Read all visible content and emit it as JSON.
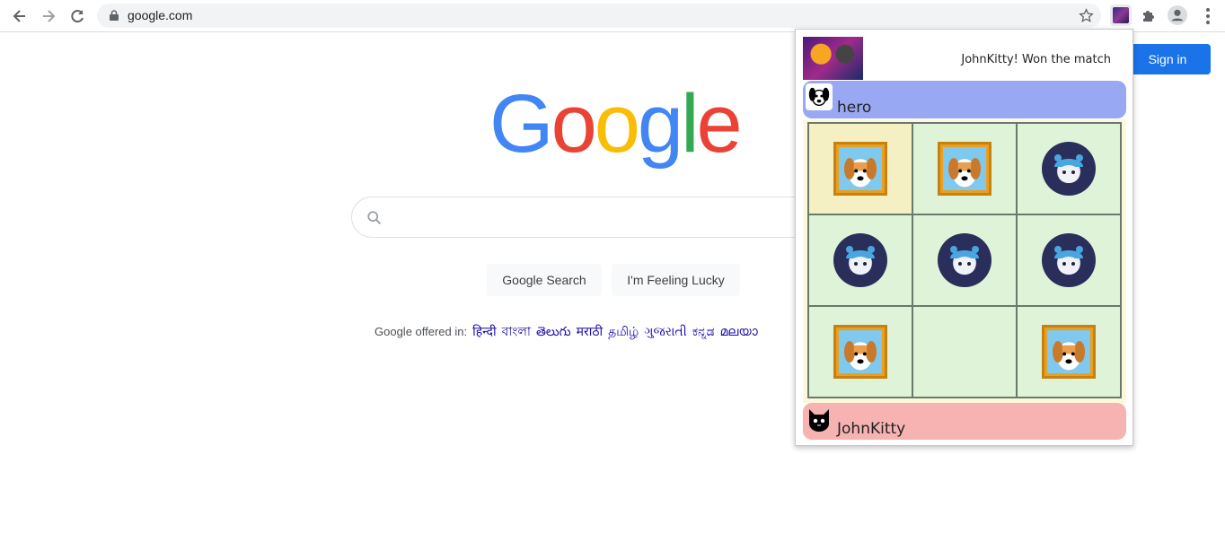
{
  "browser": {
    "url": "google.com"
  },
  "google": {
    "signin_label": "Sign in",
    "logo": [
      {
        "ch": "G",
        "color": "#4285F4"
      },
      {
        "ch": "o",
        "color": "#EA4335"
      },
      {
        "ch": "o",
        "color": "#FBBC05"
      },
      {
        "ch": "g",
        "color": "#4285F4"
      },
      {
        "ch": "l",
        "color": "#34A853"
      },
      {
        "ch": "e",
        "color": "#EA4335"
      }
    ],
    "search_button": "Google Search",
    "lucky_button": "I'm Feeling Lucky",
    "offered_label": "Google offered in:",
    "languages": [
      "हिन्दी",
      "বাংলা",
      "తెలుగు",
      "मराठी",
      "தமிழ்",
      "ગુજરાતી",
      "ಕನ್ನಡ",
      "മലയാ"
    ]
  },
  "popup": {
    "status": "JohnKitty! Won the match",
    "player_top": {
      "name": "hero",
      "color": "#98a8f2"
    },
    "player_bottom": {
      "name": "JohnKitty",
      "color": "#f7b2b2"
    },
    "board": [
      [
        "dog",
        "dog",
        "cat"
      ],
      [
        "cat",
        "cat",
        "cat"
      ],
      [
        "dog",
        "",
        "dog"
      ]
    ],
    "highlight": [
      [
        0,
        0
      ]
    ]
  }
}
